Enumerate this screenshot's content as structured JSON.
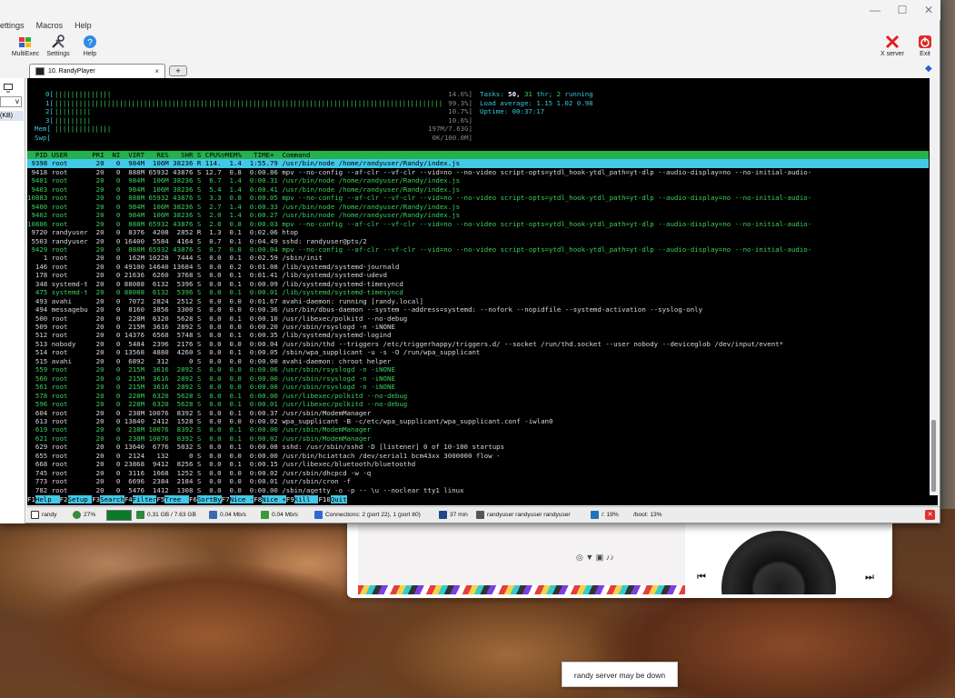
{
  "app": {
    "menu": [
      "ettings",
      "Macros",
      "Help"
    ],
    "toolbar": [
      {
        "label": "MultiExec",
        "icon": "multiexec-icon"
      },
      {
        "label": "Settings",
        "icon": "settings-icon"
      },
      {
        "label": "Help",
        "icon": "help-icon"
      },
      {
        "label": "X server",
        "icon": "x-server-icon"
      },
      {
        "label": "Exit",
        "icon": "exit-icon"
      }
    ],
    "left_panel_dropdown": "v",
    "left_panel_label": "(KB)",
    "tab": {
      "label": "10. RandyPlayer",
      "close": "×",
      "new_tab": "+"
    }
  },
  "meters": {
    "cpu0": {
      "label": "0[",
      "bar": "||||||||||||||",
      "value": "14.6%]"
    },
    "cpu1": {
      "label": "1[",
      "bar": "||||||||||||||||||||||||||||||||||||||||||||||||||||||||||||||||||||||||||||||||||||||||||||||||",
      "value": "99.3%]"
    },
    "cpu2": {
      "label": "2[",
      "bar": "|||||||||",
      "value": "10.7%]"
    },
    "cpu3": {
      "label": "3[",
      "bar": "|||||||||",
      "value": "10.6%]"
    },
    "mem": {
      "label": "Mem[",
      "bar": "||||||||||||||",
      "value": "197M/7.63G]"
    },
    "swp": {
      "label": "Swp[",
      "bar": "",
      "value": "0K/100.0M]"
    },
    "tasks": {
      "label": "Tasks:",
      "value": "50,",
      "thr_value": "31",
      "thr_label": "thr;",
      "running_value": "2",
      "running_label": "running"
    },
    "load": {
      "label": "Load average:",
      "value": "1.15 1.02 0.98"
    },
    "uptime": {
      "label": "Uptime:",
      "value": "00:37:17"
    }
  },
  "table": {
    "headers": "  PID USER      PRI  NI  VIRT   RES   SHR S CPU%▽MEM%   TIME+  Command",
    "rows": [
      {
        "t": " 9398 root       20   0  984M  106M 38236 R 114.  1.4  1:55.79 /usr/bin/node /home/randyuser/Randy/index.js",
        "c": "sel"
      },
      {
        "t": " 9418 root       20   0  888M 65932 43876 S 12.7  0.8  0:00.86 mpv --no-config --af-clr --vf-clr --vid=no --no-video script-opts=ytdl_hook-ytdl_path=yt-dlp --audio-display=no --no-initial-audio-",
        "c": "norm"
      },
      {
        "t": " 9401 root       20   0  984M  106M 38236 S  6.7  1.4  0:00.31 /usr/bin/node /home/randyuser/Randy/index.js",
        "c": "thread"
      },
      {
        "t": " 9403 root       20   0  984M  106M 38236 S  5.4  1.4  0:00.41 /usr/bin/node /home/randyuser/Randy/index.js",
        "c": "thread"
      },
      {
        "t": "10883 root       20   0  888M 65932 43876 S  3.3  0.8  0:00.05 mpv --no-config --af-clr --vf-clr --vid=no --no-video script-opts=ytdl_hook-ytdl_path=yt-dlp --audio-display=no --no-initial-audio-",
        "c": "thread"
      },
      {
        "t": " 9400 root       20   0  984M  106M 38236 S  2.7  1.4  0:00.33 /usr/bin/node /home/randyuser/Randy/index.js",
        "c": "thread"
      },
      {
        "t": " 9402 root       20   0  984M  106M 38236 S  2.0  1.4  0:00.27 /usr/bin/node /home/randyuser/Randy/index.js",
        "c": "thread"
      },
      {
        "t": "10886 root       20   0  888M 65932 43876 S  2.0  0.8  0:00.03 mpv --no-config --af-clr --vf-clr --vid=no --no-video script-opts=ytdl_hook-ytdl_path=yt-dlp --audio-display=no --no-initial-audio-",
        "c": "thread"
      },
      {
        "t": " 9720 randyuser  20   0  8376  4208  2852 R  1.3  0.1  0:02.06 htop",
        "c": "norm"
      },
      {
        "t": " 5503 randyuser  20   0 16400  5584  4164 S  0.7  0.1  0:04.49 sshd: randyuser@pts/2",
        "c": "norm"
      },
      {
        "t": " 9429 root       20   0  888M 65932 43876 S  0.7  0.8  0:00.04 mpv --no-config --af-clr --vf-clr --vid=no --no-video script-opts=ytdl_hook-ytdl_path=yt-dlp --audio-display=no --no-initial-audio-",
        "c": "thread"
      },
      {
        "t": "    1 root       20   0  162M 10228  7444 S  0.0  0.1  0:02.59 /sbin/init",
        "c": "norm"
      },
      {
        "t": "  146 root       20   0 49100 14640 13684 S  0.0  0.2  0:01.08 /lib/systemd/systemd-journald",
        "c": "norm"
      },
      {
        "t": "  178 root       20   0 21636  6260  3768 S  0.0  0.1  0:01.41 /lib/systemd/systemd-udevd",
        "c": "norm"
      },
      {
        "t": "  348 systemd-t  20   0 88088  6132  5396 S  0.0  0.1  0:00.09 /lib/systemd/systemd-timesyncd",
        "c": "norm"
      },
      {
        "t": "  475 systemd-t  20   0 88088  6132  5396 S  0.0  0.1  0:00.01 /lib/systemd/systemd-timesyncd",
        "c": "thread"
      },
      {
        "t": "  493 avahi      20   0  7072  2824  2512 S  0.0  0.0  0:01.67 avahi-daemon: running [randy.local]",
        "c": "norm"
      },
      {
        "t": "  494 messagebu  20   0  8160  3856  3300 S  0.0  0.0  0:00.36 /usr/bin/dbus-daemon --system --address=systemd: --nofork --nopidfile --systemd-activation --syslog-only",
        "c": "norm"
      },
      {
        "t": "  500 root       20   0  228M  6320  5628 S  0.0  0.1  0:00.10 /usr/libexec/polkitd --no-debug",
        "c": "norm"
      },
      {
        "t": "  509 root       20   0  215M  3616  2892 S  0.0  0.0  0:00.20 /usr/sbin/rsyslogd -n -iNONE",
        "c": "norm"
      },
      {
        "t": "  512 root       20   0 14376  6568  5748 S  0.0  0.1  0:00.35 /lib/systemd/systemd-logind",
        "c": "norm"
      },
      {
        "t": "  513 nobody     20   0  5484  2396  2176 S  0.0  0.0  0:00.04 /usr/sbin/thd --triggers /etc/triggerhappy/triggers.d/ --socket /run/thd.socket --user nobody --deviceglob /dev/input/event*",
        "c": "norm"
      },
      {
        "t": "  514 root       20   0 13568  4880  4260 S  0.0  0.1  0:00.05 /sbin/wpa_supplicant -u -s -O /run/wpa_supplicant",
        "c": "norm"
      },
      {
        "t": "  515 avahi      20   0  6892   312     0 S  0.0  0.0  0:00.00 avahi-daemon: chroot helper",
        "c": "norm"
      },
      {
        "t": "  559 root       20   0  215M  3616  2892 S  0.0  0.0  0:00.06 /usr/sbin/rsyslogd -n -iNONE",
        "c": "thread"
      },
      {
        "t": "  560 root       20   0  215M  3616  2892 S  0.0  0.0  0:00.00 /usr/sbin/rsyslogd -n -iNONE",
        "c": "thread"
      },
      {
        "t": "  561 root       20   0  215M  3616  2892 S  0.0  0.0  0:00.08 /usr/sbin/rsyslogd -n -iNONE",
        "c": "thread"
      },
      {
        "t": "  578 root       20   0  228M  6320  5628 S  0.0  0.1  0:00.00 /usr/libexec/polkitd --no-debug",
        "c": "thread"
      },
      {
        "t": "  596 root       20   0  228M  6320  5628 S  0.0  0.1  0:00.01 /usr/libexec/polkitd --no-debug",
        "c": "thread"
      },
      {
        "t": "  604 root       20   0  238M 10076  8392 S  0.0  0.1  0:00.37 /usr/sbin/ModemManager",
        "c": "norm"
      },
      {
        "t": "  613 root       20   0 13840  2412  1528 S  0.0  0.0  0:00.02 wpa_supplicant -B -c/etc/wpa_supplicant/wpa_supplicant.conf -iwlan0",
        "c": "norm"
      },
      {
        "t": "  619 root       20   0  238M 10076  8392 S  0.0  0.1  0:00.00 /usr/sbin/ModemManager",
        "c": "thread"
      },
      {
        "t": "  621 root       20   0  238M 10076  8392 S  0.0  0.1  0:00.02 /usr/sbin/ModemManager",
        "c": "thread"
      },
      {
        "t": "  629 root       20   0 13640  6776  5032 S  0.0  0.1  0:00.08 sshd: /usr/sbin/sshd -D [listener] 0 of 10-100 startups",
        "c": "norm"
      },
      {
        "t": "  655 root       20   0  2124   132     0 S  0.0  0.0  0:00.00 /usr/bin/hciattach /dev/serial1 bcm43xx 3000000 flow -",
        "c": "norm"
      },
      {
        "t": "  668 root       20   0 23868  9412  8256 S  0.0  0.1  0:00.15 /usr/libexec/bluetooth/bluetoothd",
        "c": "norm"
      },
      {
        "t": "  745 root       20   0  3116  1668  1252 S  0.0  0.0  0:00.02 /usr/sbin/dhcpcd -w -q",
        "c": "norm"
      },
      {
        "t": "  773 root       20   0  6696  2384  2184 S  0.0  0.0  0:00.01 /usr/sbin/cron -f",
        "c": "norm"
      },
      {
        "t": "  782 root       20   0  5476  1412  1308 S  0.0  0.0  0:00.00 /sbin/agetty -o -p -- \\u --noclear tty1 linux",
        "c": "norm"
      }
    ]
  },
  "fkeys": [
    {
      "k": "F1",
      "v": "Help  "
    },
    {
      "k": "F2",
      "v": "Setup "
    },
    {
      "k": "F3",
      "v": "Search"
    },
    {
      "k": "F4",
      "v": "Filter"
    },
    {
      "k": "F5",
      "v": "Tree  "
    },
    {
      "k": "F6",
      "v": "SortBy"
    },
    {
      "k": "F7",
      "v": "Nice -"
    },
    {
      "k": "F8",
      "v": "Nice +"
    },
    {
      "k": "F9",
      "v": "Kill  "
    },
    {
      "k": "F10",
      "v": "Quit"
    }
  ],
  "status": {
    "host": "randy",
    "cpu": "27%",
    "mem": "0.31 GB / 7.63 GB",
    "up": "0.04 Mb/s",
    "down": "0.04 Mb/s",
    "connections": "Connections: 2 (port 22), 1 (port 80)",
    "time": "37 min",
    "users": "randyuser  randyuser  randyuser",
    "disk_root": "/: 19%",
    "disk_boot": "/boot: 13%"
  },
  "media": {
    "prev": "⏮",
    "next": "⏭"
  },
  "toast": "randy server may be down"
}
